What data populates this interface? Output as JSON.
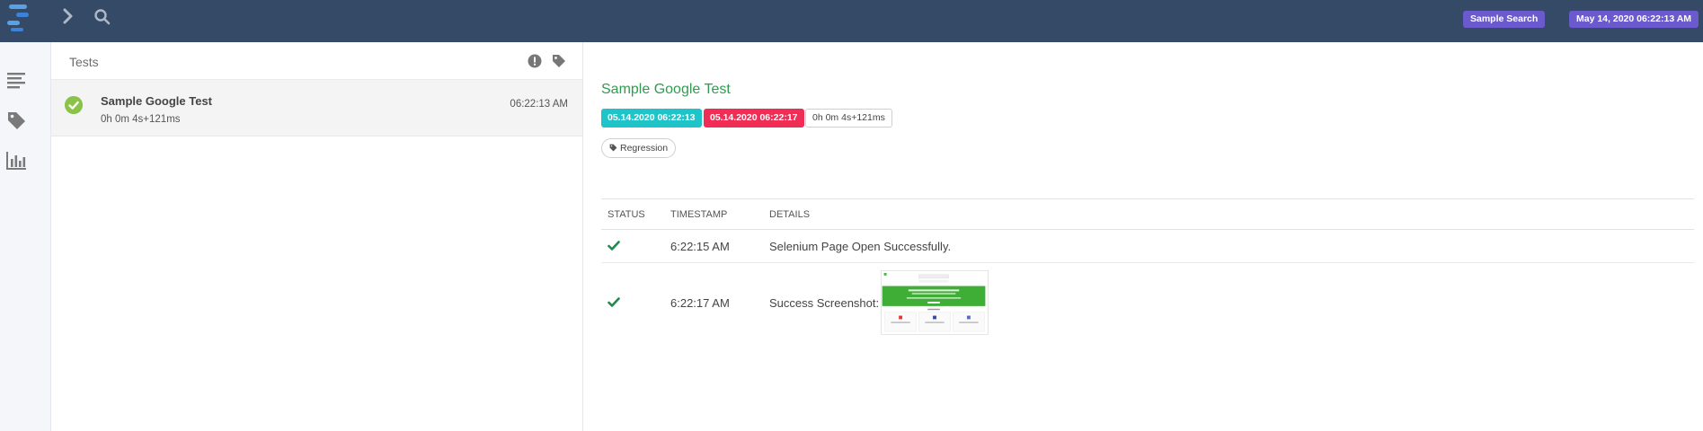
{
  "header": {
    "project_badge": "Sample Search",
    "date_badge": "May 14, 2020 06:22:13 AM",
    "icons": [
      "logo-icon",
      "chevron-right-icon",
      "search-icon"
    ]
  },
  "rail": {
    "icons": [
      "list-icon",
      "tag-icon",
      "bar-chart-icon"
    ]
  },
  "tests_panel": {
    "title": "Tests",
    "header_icons": [
      "exclamation-icon",
      "tag-icon"
    ],
    "items": [
      {
        "name": "Sample Google Test",
        "duration": "0h 0m 4s+121ms",
        "time": "06:22:13 AM",
        "status": "pass",
        "status_color": "#8bc34a"
      }
    ]
  },
  "detail": {
    "title": "Sample Google Test",
    "start": "05.14.2020 06:22:13",
    "end": "05.14.2020 06:22:17",
    "duration": "0h 0m 4s+121ms",
    "tag": "Regression",
    "colors": {
      "title": "#2e9c4f",
      "start": "#1fc4c9",
      "end": "#ef2d55",
      "pass": "#1e8a4c"
    },
    "columns": {
      "status": "STATUS",
      "timestamp": "TIMESTAMP",
      "details": "DETAILS"
    },
    "steps": [
      {
        "status": "pass",
        "timestamp": "6:22:15 AM",
        "details": "Selenium Page Open Successfully."
      },
      {
        "status": "pass",
        "timestamp": "6:22:17 AM",
        "details": "Success Screenshot:"
      }
    ]
  }
}
